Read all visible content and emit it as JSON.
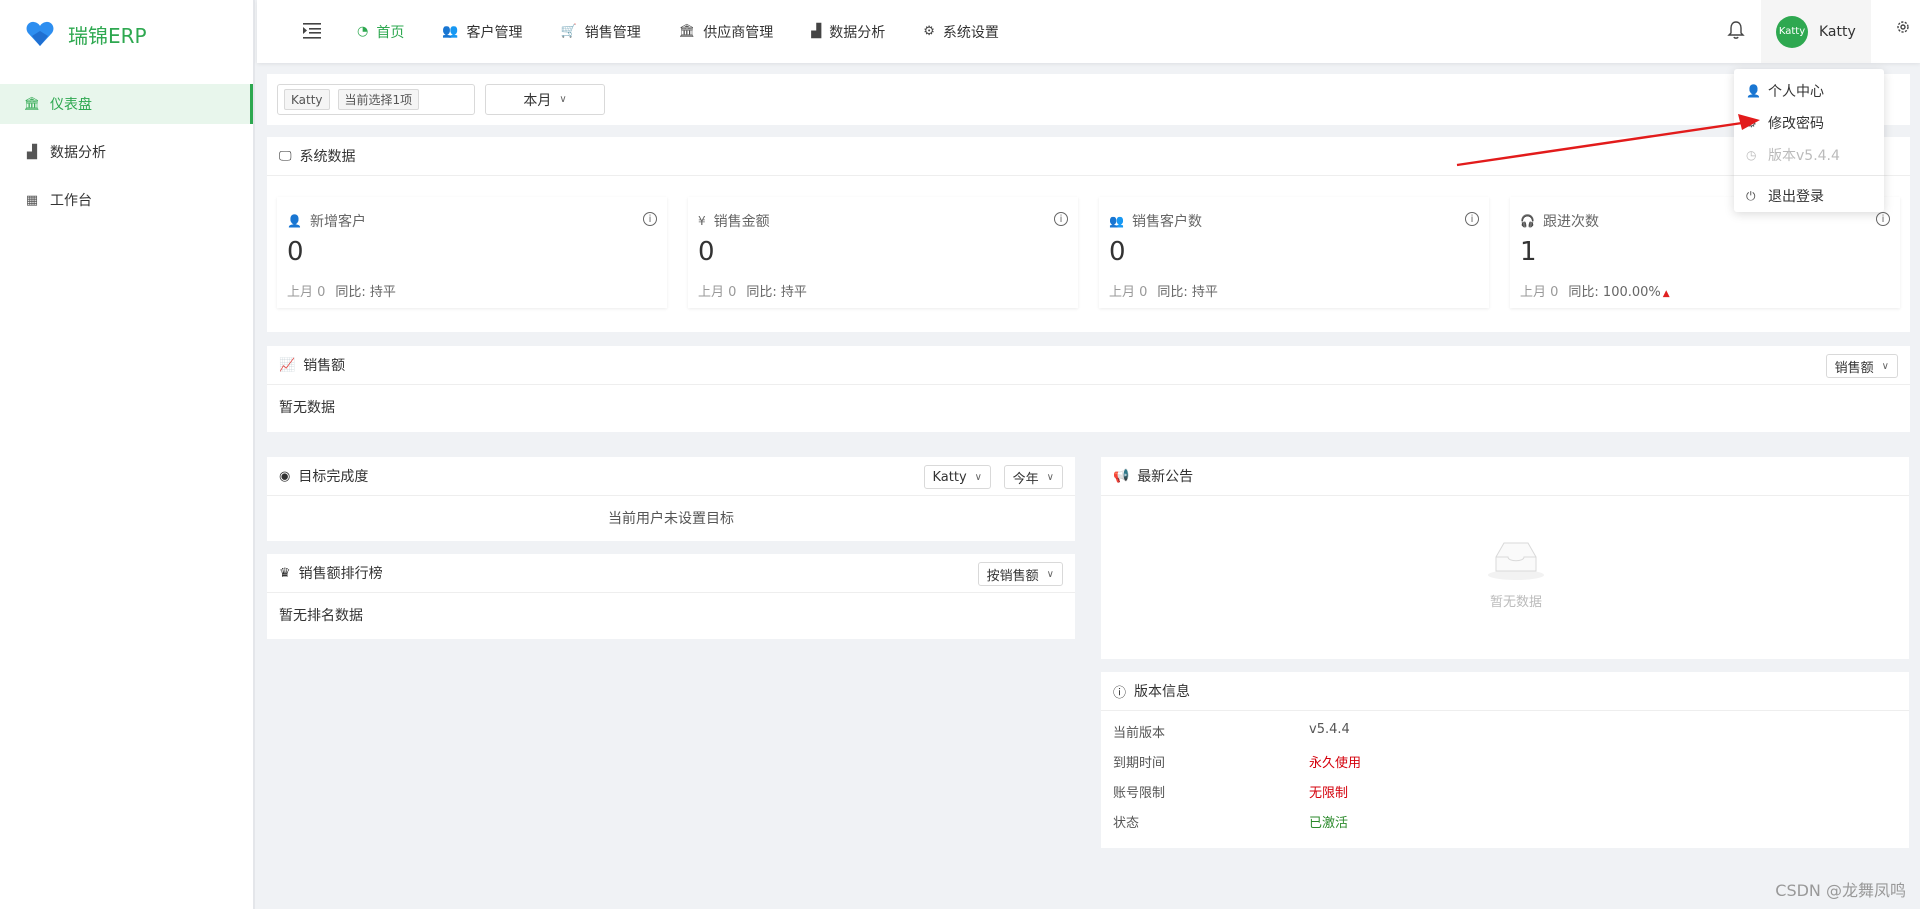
{
  "app": {
    "title": "瑞锦ERP",
    "brand_color": "#2ea850"
  },
  "sidebar": {
    "items": [
      {
        "label": "仪表盘",
        "icon": "bank-icon",
        "active": true
      },
      {
        "label": "数据分析",
        "icon": "bar-chart-icon",
        "active": false
      },
      {
        "label": "工作台",
        "icon": "calendar-icon",
        "active": false
      }
    ]
  },
  "topnav": {
    "items": [
      {
        "label": "首页",
        "icon": "dashboard-icon",
        "active": true
      },
      {
        "label": "客户管理",
        "icon": "users-icon"
      },
      {
        "label": "销售管理",
        "icon": "cart-icon"
      },
      {
        "label": "供应商管理",
        "icon": "bank-icon"
      },
      {
        "label": "数据分析",
        "icon": "bar-chart-icon"
      },
      {
        "label": "系统设置",
        "icon": "gear-icon"
      }
    ],
    "user": {
      "avatar_text": "Katty",
      "name": "Katty"
    }
  },
  "user_menu": {
    "profile": "个人中心",
    "change_password": "修改密码",
    "version": "版本v5.4.4",
    "logout": "退出登录"
  },
  "filters": {
    "user_tag": "Katty",
    "selected_count": "当前选择1项",
    "period": "本月"
  },
  "system_data": {
    "title": "系统数据",
    "cards": [
      {
        "title": "新增客户",
        "icon": "user-icon",
        "value": "0",
        "last_month": "上月 0",
        "compare": "同比: 持平"
      },
      {
        "title": "销售金额",
        "icon": "yen-icon",
        "value": "0",
        "last_month": "上月 0",
        "compare": "同比: 持平"
      },
      {
        "title": "销售客户数",
        "icon": "customer-icon",
        "value": "0",
        "last_month": "上月 0",
        "compare": "同比: 持平"
      },
      {
        "title": "跟进次数",
        "icon": "headset-icon",
        "value": "1",
        "last_month": "上月 0",
        "compare": "同比: 100.00%"
      }
    ]
  },
  "sales": {
    "title": "销售额",
    "select": "销售额",
    "empty": "暂无数据"
  },
  "target": {
    "title": "目标完成度",
    "user_select": "Katty",
    "period_select": "今年",
    "message": "当前用户未设置目标"
  },
  "ranking": {
    "title": "销售额排行榜",
    "select": "按销售额",
    "empty": "暂无排名数据"
  },
  "notice": {
    "title": "最新公告",
    "empty": "暂无数据"
  },
  "version_info": {
    "title": "版本信息",
    "rows": [
      {
        "label": "当前版本",
        "value": "v5.4.4",
        "color": "#555555"
      },
      {
        "label": "到期时间",
        "value": "永久使用",
        "color": "#d4000b"
      },
      {
        "label": "账号限制",
        "value": "无限制",
        "color": "#d4000b"
      },
      {
        "label": "状态",
        "value": "已激活",
        "color": "#2b8a2b"
      }
    ]
  },
  "watermark": "CSDN @龙舞凤鸣"
}
